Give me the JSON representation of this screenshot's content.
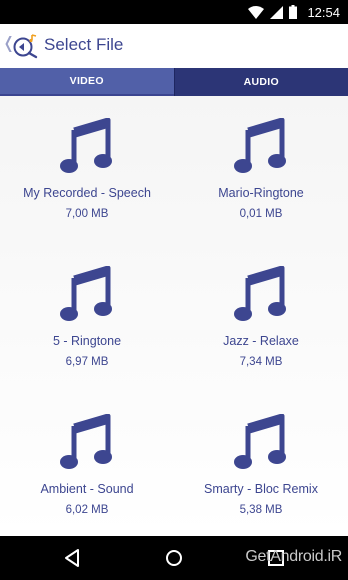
{
  "status_bar": {
    "time": "12:54",
    "icons": [
      "wifi-icon",
      "signal-icon",
      "battery-icon"
    ]
  },
  "app_bar": {
    "back_icon": "chevron-left-icon",
    "logo_icon": "app-logo-icon",
    "title": "Select File"
  },
  "tabs": [
    {
      "label": "VIDEO",
      "selected": false
    },
    {
      "label": "AUDIO",
      "selected": true
    }
  ],
  "files": [
    {
      "name": "My Recorded - Speech",
      "size": "7,00 MB",
      "icon": "music-note-icon"
    },
    {
      "name": "Mario-Ringtone",
      "size": "0,01 MB",
      "icon": "music-note-icon"
    },
    {
      "name": "5 - Ringtone",
      "size": "6,97 MB",
      "icon": "music-note-icon"
    },
    {
      "name": "Jazz - Relaxe",
      "size": "7,34 MB",
      "icon": "music-note-icon"
    },
    {
      "name": "Ambient - Sound",
      "size": "6,02 MB",
      "icon": "music-note-icon"
    },
    {
      "name": "Smarty - Bloc Remix",
      "size": "5,38 MB",
      "icon": "music-note-icon"
    }
  ],
  "nav_bar": {
    "icons": [
      "back-triangle-icon",
      "home-circle-icon",
      "recents-square-icon"
    ],
    "watermark": "GetAndroid.iR"
  },
  "colors": {
    "accent": "#3d4690",
    "tab_selected": "#2c3576",
    "tab_unselected": "#5160a8"
  }
}
